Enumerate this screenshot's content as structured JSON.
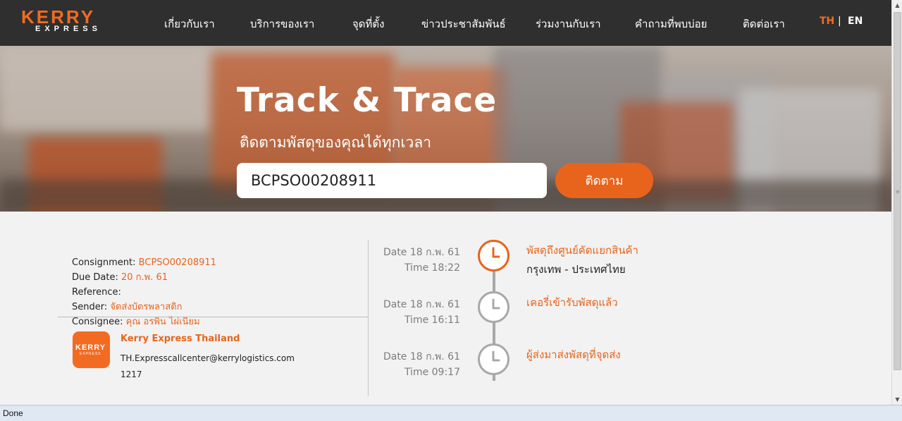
{
  "header": {
    "logo_main": "KERRY",
    "logo_sub": "EXPRESS",
    "nav": [
      "เกี่ยวกับเรา",
      "บริการของเรา",
      "จุดที่ตั้ง",
      "ข่าวประชาสัมพันธ์",
      "ร่วมงานกับเรา",
      "คำถามที่พบบ่อย",
      "ติดต่อเรา"
    ],
    "lang_th": "TH",
    "lang_sep": "|",
    "lang_en": "EN"
  },
  "hero": {
    "title": "Track & Trace",
    "subtitle": "ติดตามพัสดุของคุณได้ทุกเวลา",
    "tracking_value": "BCPSO00208911",
    "button_label": "ติดตาม"
  },
  "shipment": {
    "consignment_label": "Consignment",
    "consignment_value": "BCPSO00208911",
    "due_date_label": "Due Date",
    "due_date_value": "20 ก.พ. 61",
    "reference_label": "Reference",
    "reference_value": "",
    "sender_label": "Sender",
    "sender_value": "จัดส่งบัตรพลาสติก",
    "consignee_label": "Consignee",
    "consignee_value": "คุณ อรพิน ไผ่เนียม"
  },
  "contact": {
    "logo_main": "KERRY",
    "logo_sub": "EXPRESS",
    "name": "Kerry Express Thailand",
    "email": "TH.Expresscallcenter@kerrylogistics.com",
    "phone": "1217"
  },
  "timeline": [
    {
      "date": "Date 18 ก.พ. 61",
      "time": "Time 18:22",
      "status": "พัสดุถึงศูนย์คัดแยกสินค้า",
      "location": "กรุงเทพ - ประเทศไทย",
      "active": true
    },
    {
      "date": "Date 18 ก.พ. 61",
      "time": "Time 16:11",
      "status": "เคอรี่เข้ารับพัสดุแล้ว",
      "location": "",
      "active": false
    },
    {
      "date": "Date 18 ก.พ. 61",
      "time": "Time 09:17",
      "status": "ผู้ส่งมาส่งพัสดุที่จุดส่ง",
      "location": "",
      "active": false
    }
  ],
  "colors": {
    "accent": "#e8641c",
    "header_bg": "#2f2f2f",
    "timeline_gray": "#a8a8a8"
  },
  "statusbar": {
    "text": "Done"
  }
}
